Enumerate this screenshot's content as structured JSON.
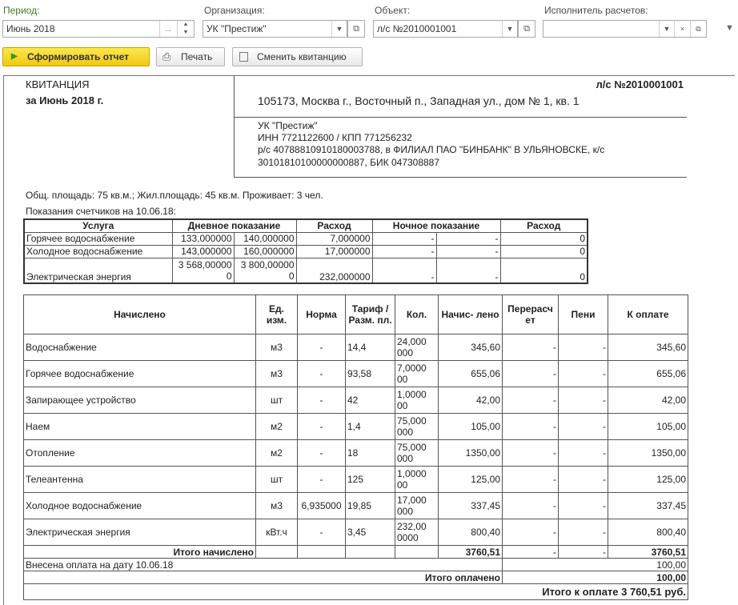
{
  "filters": {
    "period_label": "Период:",
    "period_value": "Июнь 2018",
    "org_label": "Организация:",
    "org_value": "УК \"Престиж\"",
    "object_label": "Объект:",
    "object_value": "л/с №2010001001",
    "executor_label": "Исполнитель расчетов:",
    "executor_value": ""
  },
  "toolbar": {
    "generate_label": "Сформировать отчет",
    "print_label": "Печать",
    "change_label": "Сменить квитанцию"
  },
  "receipt": {
    "title": "КВИТАНЦИЯ",
    "period_text": "за Июнь 2018 г.",
    "account": "л/с №2010001001",
    "address": "105173, Москва г., Восточный п., Западная ул., дом № 1, кв. 1",
    "org_name": "УК \"Престиж\"",
    "org_inn": "ИНН 7721122600 / КПП 771256232",
    "org_bank_1": "р/с 40788810910180003788, в ФИЛИАЛ ПАО \"БИНБАНК\" В УЛЬЯНОВСКЕ, к/с",
    "org_bank_2": "30101810100000000887, БИК 047308887",
    "area_info": "Общ. площадь: 75 кв.м.; Жил.площадь: 45 кв.м. Проживает: 3 чел.",
    "meters_caption": "Показания счетчиков на 10.06.18:"
  },
  "meters": {
    "headers": [
      "Услуга",
      "Дневное показание",
      "Расход",
      "Ночное показание",
      "Расход"
    ],
    "rows": [
      {
        "service": "Горячее водоснабжение",
        "d1": "133,000000",
        "d2": "140,000000",
        "dc": "7,000000",
        "n1": "-",
        "n2": "-",
        "nc": "0"
      },
      {
        "service": "Холодное водоснабжение",
        "d1": "143,000000",
        "d2": "160,000000",
        "dc": "17,000000",
        "n1": "-",
        "n2": "-",
        "nc": "0"
      },
      {
        "service": "Электрическая энергия",
        "d1": "3 568,00000 0",
        "d2": "3 800,00000 0",
        "dc": "232,000000",
        "n1": "-",
        "n2": "-",
        "nc": "0"
      }
    ]
  },
  "charges": {
    "headers": [
      "Начислено",
      "Ед. изм.",
      "Норма",
      "Тариф / Разм. пл.",
      "Кол.",
      "Начис- лено",
      "Перерасч ет",
      "Пени",
      "К оплате"
    ],
    "rows": [
      {
        "name": "Водоснабжение",
        "unit": "м3",
        "norm": "-",
        "tariff": "14,4",
        "qty": "24,000 000",
        "charged": "345,60",
        "recalc": "-",
        "fine": "-",
        "pay": "345,60"
      },
      {
        "name": "Горячее водоснабжение",
        "unit": "м3",
        "norm": "-",
        "tariff": "93,58",
        "qty": "7,0000 00",
        "charged": "655,06",
        "recalc": "-",
        "fine": "-",
        "pay": "655,06"
      },
      {
        "name": "Запирающее устройство",
        "unit": "шт",
        "norm": "-",
        "tariff": "42",
        "qty": "1,0000 00",
        "charged": "42,00",
        "recalc": "-",
        "fine": "-",
        "pay": "42,00"
      },
      {
        "name": "Наем",
        "unit": "м2",
        "norm": "-",
        "tariff": "1,4",
        "qty": "75,000 000",
        "charged": "105,00",
        "recalc": "-",
        "fine": "-",
        "pay": "105,00"
      },
      {
        "name": "Отопление",
        "unit": "м2",
        "norm": "-",
        "tariff": "18",
        "qty": "75,000 000",
        "charged": "1350,00",
        "recalc": "-",
        "fine": "-",
        "pay": "1350,00"
      },
      {
        "name": "Телеантенна",
        "unit": "шт",
        "norm": "-",
        "tariff": "125",
        "qty": "1,0000 00",
        "charged": "125,00",
        "recalc": "-",
        "fine": "-",
        "pay": "125,00"
      },
      {
        "name": "Холодное водоснабжение",
        "unit": "м3",
        "norm": "6,935000",
        "tariff": "19,85",
        "qty": "17,000 000",
        "charged": "337,45",
        "recalc": "-",
        "fine": "-",
        "pay": "337,45"
      },
      {
        "name": "Электрическая энергия",
        "unit": "кВт.ч",
        "norm": "-",
        "tariff": "3,45",
        "qty": "232,00 0000",
        "charged": "800,40",
        "recalc": "-",
        "fine": "-",
        "pay": "800,40"
      }
    ],
    "total_label": "Итого начислено",
    "total_charged": "3760,51",
    "total_recalc": "-",
    "total_fine": "-",
    "total_pay": "3760,51",
    "paid_label": "Внесена оплата на дату 10.06.18",
    "paid_value": "100,00",
    "paid_total_label": "Итого оплачено",
    "paid_total_value": "100,00",
    "grand_total": "Итого к оплате 3 760,51 руб."
  }
}
